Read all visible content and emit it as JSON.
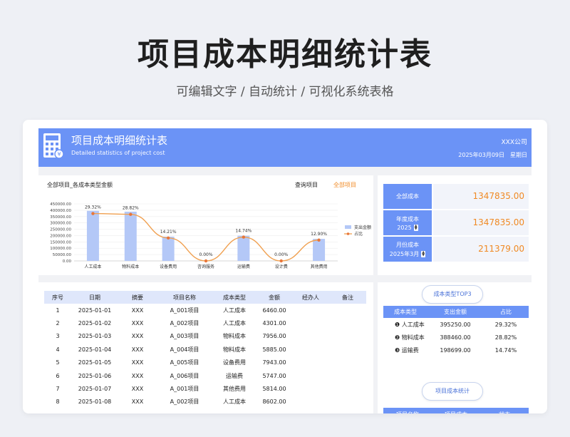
{
  "page": {
    "title": "项目成本明细统计表",
    "subtitle": "可编辑文字 / 自动统计 / 可视化系统表格"
  },
  "banner": {
    "title": "项目成本明细统计表",
    "subtitle_en": "Detailed statistics of project cost",
    "company": "XXX公司",
    "date": "2025年03月09日",
    "weekday": "星期日"
  },
  "chart_panel": {
    "title": "全部项目_各成本类型金额",
    "query_label": "查询项目",
    "query_value": "全部项目"
  },
  "chart_data": {
    "type": "bar",
    "categories": [
      "人工成本",
      "物料成本",
      "设备费用",
      "咨询服务",
      "运输费",
      "设计费",
      "其他费用"
    ],
    "series": [
      {
        "name": "支出金额",
        "type": "bar",
        "values": [
          395250,
          388460,
          191500,
          0,
          198699,
          0,
          173926
        ]
      },
      {
        "name": "占比",
        "type": "line",
        "values": [
          29.32,
          28.82,
          14.21,
          0.0,
          14.74,
          0.0,
          12.9
        ]
      }
    ],
    "data_labels": [
      "29.32%",
      "28.82%",
      "14.21%",
      "0.00%",
      "14.74%",
      "0.00%",
      "12.90%"
    ],
    "y_ticks": [
      "450000.00",
      "400000.00",
      "350000.00",
      "300000.00",
      "250000.00",
      "200000.00",
      "150000.00",
      "100000.00",
      "50000.00",
      "0.00"
    ],
    "ylim": [
      0,
      450000
    ],
    "legend_position": "right",
    "colors": {
      "bar": "#b4c8f7",
      "line": "#f0a050",
      "marker": "#e8763a"
    }
  },
  "summary": {
    "total_label": "全部成本",
    "total_value": "1347835.00",
    "year_label": "年度成本",
    "year": "2025",
    "year_value": "1347835.00",
    "month_label": "月份成本",
    "month": "2025年3月",
    "month_value": "211379.00"
  },
  "table": {
    "headers": [
      "序号",
      "日期",
      "摘要",
      "项目名称",
      "成本类型",
      "金额",
      "经办人",
      "备注"
    ],
    "rows": [
      [
        "1",
        "2025-01-01",
        "XXX",
        "A_001项目",
        "人工成本",
        "6460.00",
        "",
        ""
      ],
      [
        "2",
        "2025-01-02",
        "XXX",
        "A_002项目",
        "人工成本",
        "4301.00",
        "",
        ""
      ],
      [
        "3",
        "2025-01-03",
        "XXX",
        "A_003项目",
        "物料成本",
        "7956.00",
        "",
        ""
      ],
      [
        "4",
        "2025-01-04",
        "XXX",
        "A_004项目",
        "物料成本",
        "5885.00",
        "",
        ""
      ],
      [
        "5",
        "2025-01-05",
        "XXX",
        "A_005项目",
        "设备费用",
        "7943.00",
        "",
        ""
      ],
      [
        "6",
        "2025-01-06",
        "XXX",
        "A_006项目",
        "运输费",
        "5747.00",
        "",
        ""
      ],
      [
        "7",
        "2025-01-07",
        "XXX",
        "A_001项目",
        "其他费用",
        "5814.00",
        "",
        ""
      ],
      [
        "8",
        "2025-01-08",
        "XXX",
        "A_002项目",
        "人工成本",
        "8602.00",
        "",
        ""
      ]
    ]
  },
  "top3": {
    "title": "成本类型TOP3",
    "headers": [
      "成本类型",
      "支出金额",
      "占比"
    ],
    "rows": [
      {
        "rank": "❶",
        "name": "人工成本",
        "amount": "395250.00",
        "pct": "29.32%"
      },
      {
        "rank": "❷",
        "name": "物料成本",
        "amount": "388460.00",
        "pct": "28.82%"
      },
      {
        "rank": "❸",
        "name": "运输费",
        "amount": "198699.00",
        "pct": "14.74%"
      }
    ]
  },
  "project_stats": {
    "title": "项目成本统计",
    "headers": [
      "项目名称",
      "项目成本",
      "状态"
    ]
  },
  "colors": {
    "accent": "#6b93f6",
    "highlight": "#f08a24",
    "header_light": "#dfe7fb"
  }
}
